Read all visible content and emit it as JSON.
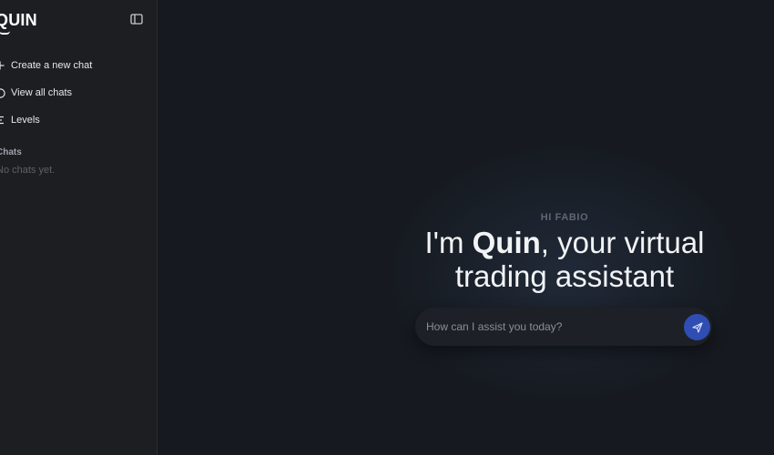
{
  "brand": {
    "logo_q": "Q",
    "logo_rest": "UIN"
  },
  "sidebar": {
    "items": [
      {
        "label": "Create a new chat",
        "icon": "plus-icon"
      },
      {
        "label": "View all chats",
        "icon": "circle-icon"
      },
      {
        "label": "Levels",
        "icon": "list-icon"
      }
    ],
    "section_title": "Chats",
    "empty_text": "No chats yet."
  },
  "main": {
    "hi": "HI FABIO",
    "headline_prefix": "I'm ",
    "headline_name": "Quin",
    "headline_suffix": ", your virtual trading assistant",
    "input_placeholder": "How can I assist you today?"
  },
  "colors": {
    "accent": "#2f4db3",
    "sidebar_bg": "#1c1e22",
    "main_bg": "#161a20"
  }
}
